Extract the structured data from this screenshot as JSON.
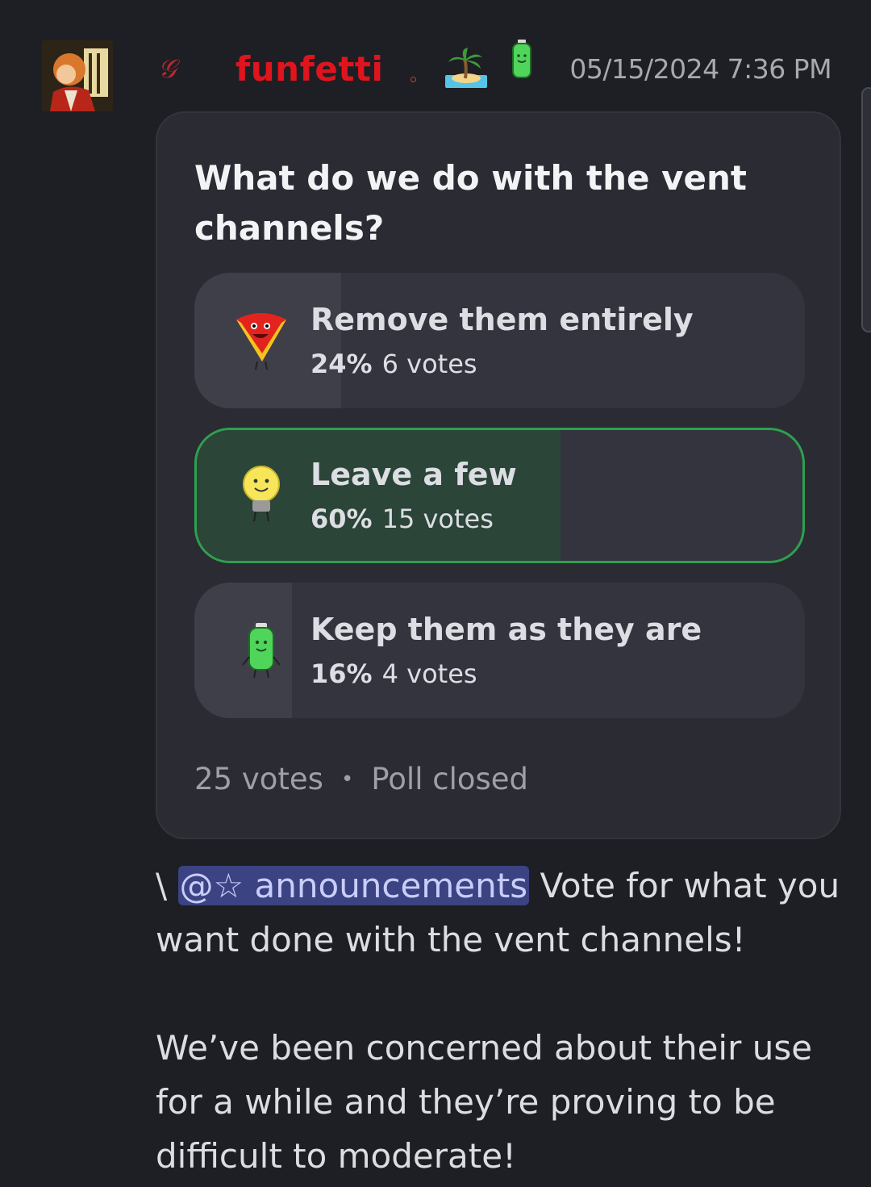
{
  "author": {
    "guild_tag": "𝒢",
    "name": "funfetti",
    "timestamp": "05/15/2024 7:36 PM",
    "avatar": "avatar",
    "badges": [
      "palm-island-icon",
      "green-battery-icon"
    ]
  },
  "poll": {
    "question": "What do we do with the vent channels?",
    "options": [
      {
        "label": "Remove them entirely",
        "percent": "24%",
        "votes": "6 votes",
        "fraction": 0.24,
        "icon": "red-character-icon",
        "winner": false
      },
      {
        "label": "Leave a few",
        "percent": "60%",
        "votes": "15 votes",
        "fraction": 0.6,
        "icon": "lightbulb-character-icon",
        "winner": true
      },
      {
        "label": "Keep them as they are",
        "percent": "16%",
        "votes": "4 votes",
        "fraction": 0.16,
        "icon": "green-battery-character-icon",
        "winner": false
      }
    ],
    "total_votes": "25 votes",
    "separator": "•",
    "status": "Poll closed"
  },
  "message": {
    "prefix": "\\ ",
    "mention": "@☆ announcements",
    "text1": " Vote for what you want done with the vent channels!",
    "text2": "We’ve been concerned about their use for a while and they’re proving to be difficult to moderate!"
  },
  "colors": {
    "background": "#1e1f24",
    "username": "#e0141d",
    "winner_border": "#2ea04f",
    "mention_bg": "#3c4382"
  }
}
